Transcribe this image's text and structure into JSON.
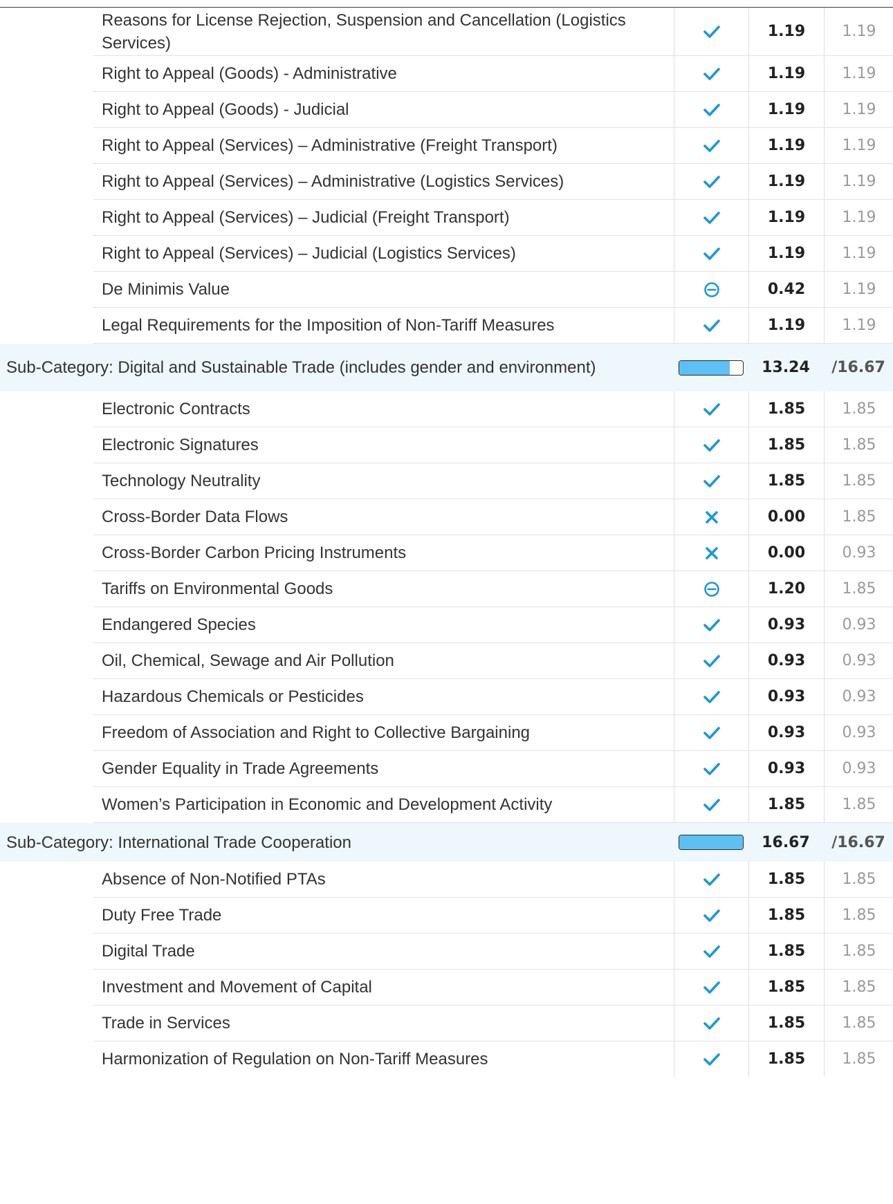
{
  "colors": {
    "accent": "#1a9ad6",
    "bar_fill": "#5cc0f5",
    "subcategory_bg": "#eef7fc"
  },
  "rows": [
    {
      "kind": "item",
      "label": "Reasons for License Rejection, Suspension and Cancellation (Logistics Services)",
      "status": "check",
      "score": "1.19",
      "max": "1.19"
    },
    {
      "kind": "item",
      "label": "Right to Appeal (Goods) - Administrative",
      "status": "check",
      "score": "1.19",
      "max": "1.19"
    },
    {
      "kind": "item",
      "label": "Right to Appeal (Goods) - Judicial",
      "status": "check",
      "score": "1.19",
      "max": "1.19"
    },
    {
      "kind": "item",
      "label": "Right to Appeal (Services) – Administrative (Freight Transport)",
      "status": "check",
      "score": "1.19",
      "max": "1.19"
    },
    {
      "kind": "item",
      "label": "Right to Appeal (Services) – Administrative (Logistics Services)",
      "status": "check",
      "score": "1.19",
      "max": "1.19"
    },
    {
      "kind": "item",
      "label": "Right to Appeal (Services) – Judicial (Freight Transport)",
      "status": "check",
      "score": "1.19",
      "max": "1.19"
    },
    {
      "kind": "item",
      "label": "Right to Appeal (Services) – Judicial (Logistics Services)",
      "status": "check",
      "score": "1.19",
      "max": "1.19"
    },
    {
      "kind": "item",
      "label": "De Minimis Value",
      "status": "partial",
      "score": "0.42",
      "max": "1.19"
    },
    {
      "kind": "item",
      "label": "Legal Requirements for the Imposition of Non-Tariff Measures",
      "status": "check",
      "score": "1.19",
      "max": "1.19"
    },
    {
      "kind": "sub",
      "label": "Sub-Category: Digital and Sustainable Trade (includes gender and environment)",
      "fraction": 0.794,
      "score": "13.24",
      "max": "/16.67"
    },
    {
      "kind": "item",
      "label": "Electronic Contracts",
      "status": "check",
      "score": "1.85",
      "max": "1.85"
    },
    {
      "kind": "item",
      "label": "Electronic Signatures",
      "status": "check",
      "score": "1.85",
      "max": "1.85"
    },
    {
      "kind": "item",
      "label": "Technology Neutrality",
      "status": "check",
      "score": "1.85",
      "max": "1.85"
    },
    {
      "kind": "item",
      "label": "Cross-Border Data Flows",
      "status": "cross",
      "score": "0.00",
      "max": "1.85"
    },
    {
      "kind": "item",
      "label": "Cross-Border Carbon Pricing Instruments",
      "status": "cross",
      "score": "0.00",
      "max": "0.93"
    },
    {
      "kind": "item",
      "label": "Tariffs on Environmental Goods",
      "status": "partial",
      "score": "1.20",
      "max": "1.85"
    },
    {
      "kind": "item",
      "label": "Endangered Species",
      "status": "check",
      "score": "0.93",
      "max": "0.93"
    },
    {
      "kind": "item",
      "label": "Oil, Chemical, Sewage and Air Pollution",
      "status": "check",
      "score": "0.93",
      "max": "0.93"
    },
    {
      "kind": "item",
      "label": "Hazardous Chemicals or Pesticides",
      "status": "check",
      "score": "0.93",
      "max": "0.93"
    },
    {
      "kind": "item",
      "label": "Freedom of Association and Right to Collective Bargaining",
      "status": "check",
      "score": "0.93",
      "max": "0.93"
    },
    {
      "kind": "item",
      "label": "Gender Equality in Trade Agreements",
      "status": "check",
      "score": "0.93",
      "max": "0.93"
    },
    {
      "kind": "item",
      "label": "Women’s Participation in Economic and Development Activity",
      "status": "check",
      "score": "1.85",
      "max": "1.85"
    },
    {
      "kind": "sub",
      "label": "Sub-Category: International Trade Cooperation",
      "fraction": 1.0,
      "score": "16.67",
      "max": "/16.67"
    },
    {
      "kind": "item",
      "label": "Absence of Non-Notified PTAs",
      "status": "check",
      "score": "1.85",
      "max": "1.85"
    },
    {
      "kind": "item",
      "label": "Duty Free Trade",
      "status": "check",
      "score": "1.85",
      "max": "1.85"
    },
    {
      "kind": "item",
      "label": "Digital Trade",
      "status": "check",
      "score": "1.85",
      "max": "1.85"
    },
    {
      "kind": "item",
      "label": "Investment and Movement of Capital",
      "status": "check",
      "score": "1.85",
      "max": "1.85"
    },
    {
      "kind": "item",
      "label": "Trade in Services",
      "status": "check",
      "score": "1.85",
      "max": "1.85"
    },
    {
      "kind": "item",
      "label": "Harmonization of Regulation on Non-Tariff Measures",
      "status": "check",
      "score": "1.85",
      "max": "1.85"
    }
  ]
}
